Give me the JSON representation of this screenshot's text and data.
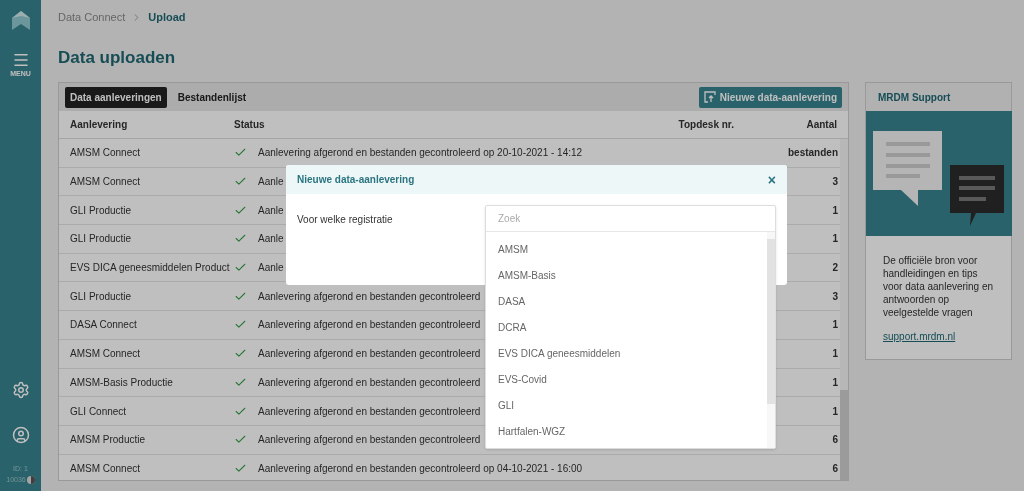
{
  "sidebar": {
    "menu_label": "MENU",
    "id_label": "ID: 1",
    "build": "10036"
  },
  "breadcrumb": [
    {
      "label": "Data Connect",
      "current": false
    },
    {
      "label": "Upload",
      "current": true
    }
  ],
  "page_title": "Data uploaden",
  "tabs": [
    {
      "label": "Data aanleveringen",
      "selected": true
    },
    {
      "label": "Bestandenlijst",
      "selected": false
    }
  ],
  "new_button": "Nieuwe data-aanlevering",
  "table": {
    "columns": [
      "Aanlevering",
      "Status",
      "Topdesk nr.",
      "Aantal"
    ],
    "rows": [
      {
        "aanlevering": "AMSM Connect",
        "done": true,
        "status": "Aanlevering afgerond en bestanden gecontroleerd op 20-10-2021 - 14:12",
        "aantal": "bestanden"
      },
      {
        "aanlevering": "AMSM Connect",
        "done": true,
        "status": "Aanle",
        "aantal": "3"
      },
      {
        "aanlevering": "GLI Productie",
        "done": true,
        "status": "Aanle",
        "aantal": "1"
      },
      {
        "aanlevering": "GLI Productie",
        "done": true,
        "status": "Aanle",
        "aantal": "1"
      },
      {
        "aanlevering": "EVS DICA geneesmiddelen Product",
        "done": true,
        "status": "Aanle",
        "aantal": "2"
      },
      {
        "aanlevering": "GLI Productie",
        "done": true,
        "status": "Aanlevering afgerond en bestanden gecontroleerd",
        "aantal": "3"
      },
      {
        "aanlevering": "DASA Connect",
        "done": true,
        "status": "Aanlevering afgerond en bestanden gecontroleerd",
        "aantal": "1"
      },
      {
        "aanlevering": "AMSM Connect",
        "done": true,
        "status": "Aanlevering afgerond en bestanden gecontroleerd",
        "aantal": "1"
      },
      {
        "aanlevering": "AMSM-Basis Productie",
        "done": true,
        "status": "Aanlevering afgerond en bestanden gecontroleerd",
        "aantal": "1"
      },
      {
        "aanlevering": "GLI Connect",
        "done": true,
        "status": "Aanlevering afgerond en bestanden gecontroleerd",
        "aantal": "1"
      },
      {
        "aanlevering": "AMSM Productie",
        "done": true,
        "status": "Aanlevering afgerond en bestanden gecontroleerd",
        "aantal": "6"
      },
      {
        "aanlevering": "AMSM Connect",
        "done": true,
        "status": "Aanlevering afgerond en bestanden gecontroleerd op 04-10-2021 - 16:00",
        "aantal": "6"
      }
    ]
  },
  "modal": {
    "title": "Nieuwe data-aanlevering",
    "close": "×",
    "field_label": "Voor welke registratie",
    "search": {
      "placeholder": "Zoek"
    },
    "options": [
      "AMSM",
      "AMSM-Basis",
      "DASA",
      "DCRA",
      "EVS DICA geneesmiddelen",
      "EVS-Covid",
      "GLI",
      "Hartfalen-WGZ"
    ]
  },
  "support": {
    "title": "MRDM Support",
    "text": "De officiële bron voor handleidingen en tips voor data aanlevering en antwoorden op veelgestelde vragen",
    "link": "support.mrdm.nl"
  }
}
